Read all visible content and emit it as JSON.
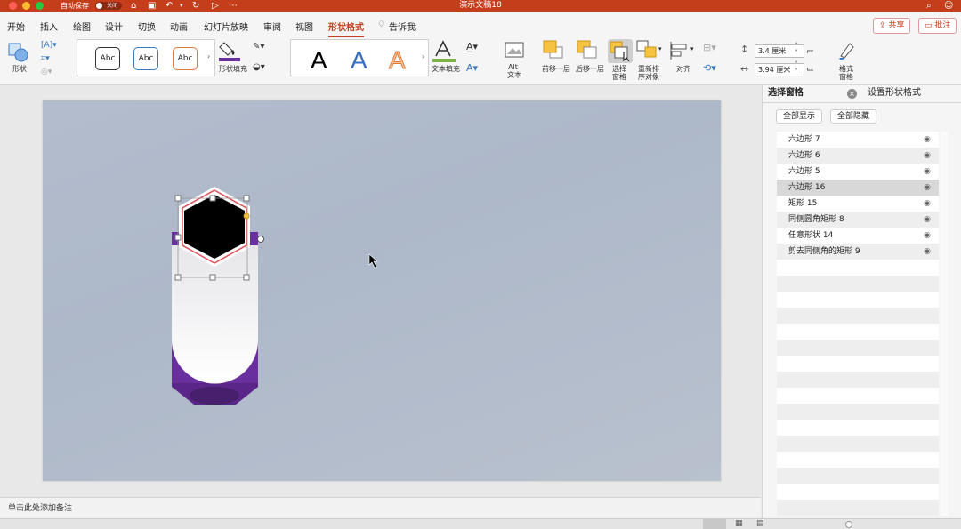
{
  "titlebar": {
    "autosave_label": "自动保存",
    "autosave_state": "关闭",
    "doc_title": "演示文稿18"
  },
  "tabs": [
    {
      "label": "开始"
    },
    {
      "label": "插入"
    },
    {
      "label": "绘图"
    },
    {
      "label": "设计"
    },
    {
      "label": "切换"
    },
    {
      "label": "动画"
    },
    {
      "label": "幻灯片放映"
    },
    {
      "label": "审阅"
    },
    {
      "label": "视图"
    },
    {
      "label": "形状格式",
      "active": true
    },
    {
      "label": "告诉我"
    }
  ],
  "share_label": "共享",
  "comments_label": "批注",
  "ribbon": {
    "shapes_label": "形状",
    "style_samples": [
      "Abc",
      "Abc",
      "Abc"
    ],
    "shape_fill_label": "形状填充",
    "wordart_letters": [
      "A",
      "A",
      "A"
    ],
    "text_fill_label": "文本填充",
    "alt_text_label1": "Alt",
    "alt_text_label2": "文本",
    "bring_forward_label": "前移一层",
    "send_backward_label": "后移一层",
    "selection_pane_label1": "选择",
    "selection_pane_label2": "窗格",
    "reorder_label1": "重新排",
    "reorder_label2": "序对象",
    "align_label": "对齐",
    "height_value": "3.4 厘米",
    "width_value": "3.94 厘米",
    "format_pane_label1": "格式",
    "format_pane_label2": "窗格"
  },
  "notes_placeholder": "单击此处添加备注",
  "selection_pane": {
    "tab_selection": "选择窗格",
    "tab_format": "设置形状格式",
    "show_all": "全部显示",
    "hide_all": "全部隐藏",
    "items": [
      {
        "name": "六边形 7"
      },
      {
        "name": "六边形 6"
      },
      {
        "name": "六边形 5"
      },
      {
        "name": "六边形 16",
        "selected": true
      },
      {
        "name": "矩形 15"
      },
      {
        "name": "同侧圆角矩形 8"
      },
      {
        "name": "任意形状 14"
      },
      {
        "name": "剪去同侧角的矩形 9"
      }
    ]
  },
  "colors": {
    "titlebar": "#c43e1c",
    "accent": "#c43e1c",
    "purple": "#6a2f9e",
    "hexagon_fill": "#000000",
    "hexagon_outline": "#e0535a"
  }
}
